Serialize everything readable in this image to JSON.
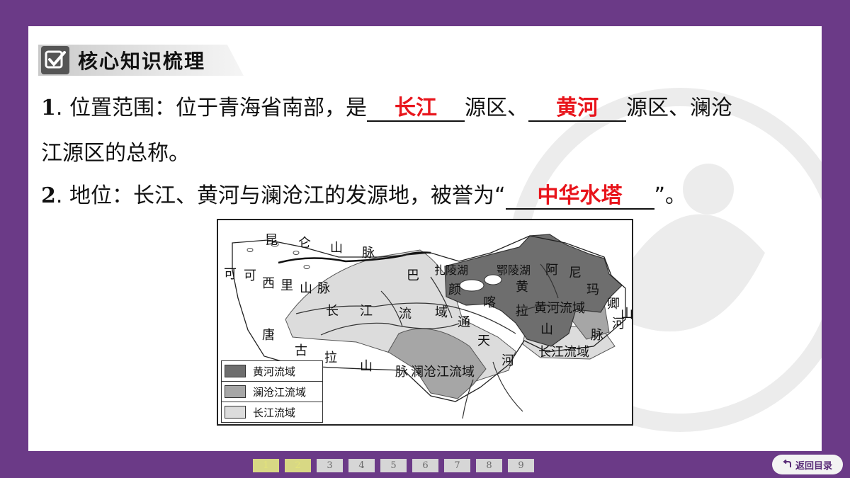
{
  "header": {
    "title": "核心知识梳理",
    "icon": "checkbox-check-icon"
  },
  "items": [
    {
      "num": "1",
      "text_before": ". 位置范围：位于青海省南部，是",
      "blank1": "长江",
      "text_mid": "源区、",
      "blank2": "黄河",
      "text_after": "源区、澜沧",
      "text_line2": "江源区的总称。"
    },
    {
      "num": "2",
      "text_before": ". 地位：长江、黄河与澜沧江的发源地，被誉为“",
      "blank1": "中华水塔",
      "text_after": "”。"
    }
  ],
  "map": {
    "labels": [
      "昆",
      "仑",
      "山",
      "脉",
      "可",
      "可",
      "西",
      "里",
      "山",
      "脉",
      "巴",
      "扎陵湖",
      "鄂陵湖",
      "颜",
      "喀",
      "阿",
      "尼",
      "黄",
      "玛",
      "卿",
      "拉",
      "黄河流域",
      "山",
      "山",
      "长",
      "江",
      "流",
      "域",
      "通",
      "脉",
      "唐",
      "天",
      "古",
      "拉",
      "山",
      "河",
      "长江流域",
      "脉",
      "澜沧江流域",
      "河"
    ],
    "legend": [
      {
        "label": "黄河流域",
        "color": "#6e6e6e"
      },
      {
        "label": "澜沧江流域",
        "color": "#a6a6a6"
      },
      {
        "label": "长江流域",
        "color": "#dcdcdc"
      }
    ]
  },
  "pager": {
    "pages": [
      "1",
      "2",
      "3",
      "4",
      "5",
      "6",
      "7",
      "8",
      "9"
    ],
    "active": [
      "1",
      "2"
    ]
  },
  "nav": {
    "back_label": "返回目录",
    "back_icon": "return-arrow-icon"
  },
  "colors": {
    "frame": "#6b3a87",
    "answer": "#e8141b"
  }
}
